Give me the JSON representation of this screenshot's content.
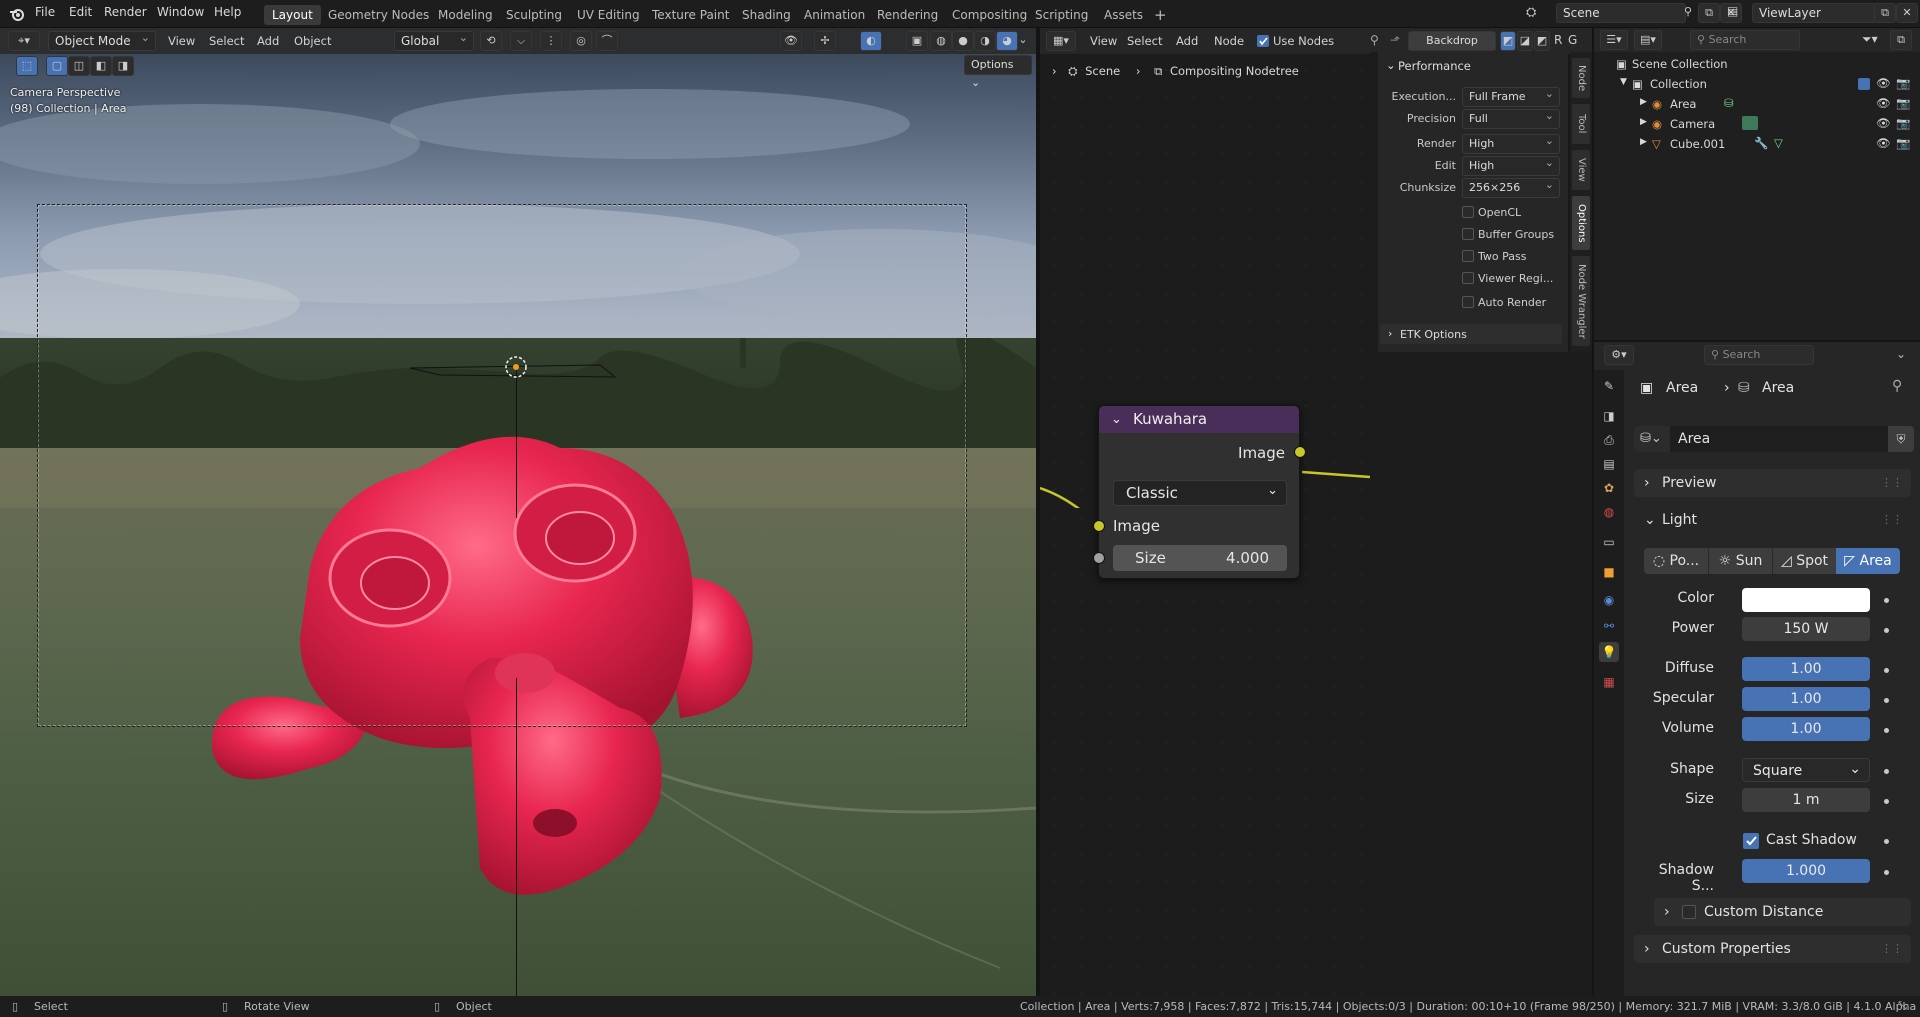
{
  "topbar": {
    "menus": [
      "File",
      "Edit",
      "Render",
      "Window",
      "Help"
    ],
    "workspaces": [
      "Layout",
      "Geometry Nodes",
      "Modeling",
      "Sculpting",
      "UV Editing",
      "Texture Paint",
      "Shading",
      "Animation",
      "Rendering",
      "Compositing",
      "Scripting",
      "Assets"
    ],
    "active_workspace": "Layout",
    "add_tab": "+",
    "scene": "Scene",
    "view_layer": "ViewLayer"
  },
  "viewport": {
    "mode": "Object Mode",
    "menus": [
      "View",
      "Select",
      "Add",
      "Object"
    ],
    "orientation": "Global",
    "options_label": "Options",
    "overlay_line1": "Camera Perspective",
    "overlay_line2": "(98) Collection | Area"
  },
  "node_editor": {
    "menus": [
      "View",
      "Select",
      "Add",
      "Node"
    ],
    "use_nodes_label": "Use Nodes",
    "use_nodes_checked": true,
    "backdrop_label": "Backdrop",
    "breadcrumb_scene": "Scene",
    "breadcrumb_tree": "Compositing Nodetree",
    "node": {
      "title": "Kuwahara",
      "output_label": "Image",
      "variation": "Classic",
      "input_label": "Image",
      "size_label": "Size",
      "size_value": "4.000"
    }
  },
  "performance_panel": {
    "title": "Performance",
    "rows": [
      {
        "label": "Execution...",
        "value": "Full Frame"
      },
      {
        "label": "Precision",
        "value": "Full"
      },
      {
        "label": "Render",
        "value": "High"
      },
      {
        "label": "Edit",
        "value": "High"
      },
      {
        "label": "Chunksize",
        "value": "256×256"
      }
    ],
    "checkboxes": [
      "OpenCL",
      "Buffer Groups",
      "Two Pass",
      "Viewer Regi...",
      "Auto Render"
    ],
    "etk_label": "ETK Options",
    "side_tabs": [
      "Node",
      "Tool",
      "View",
      "Options",
      "Node Wrangler"
    ]
  },
  "outliner": {
    "search_placeholder": "Search",
    "root": "Scene Collection",
    "collection": "Collection",
    "items": [
      "Area",
      "Camera",
      "Cube.001"
    ]
  },
  "properties": {
    "search_placeholder": "Search",
    "breadcrumb_object": "Area",
    "breadcrumb_data": "Area",
    "datablock_name": "Area",
    "sections": {
      "preview": "Preview",
      "light": "Light",
      "custom_distance": "Custom Distance",
      "custom_properties": "Custom Properties"
    },
    "light_types": [
      "Po...",
      "Sun",
      "Spot",
      "Area"
    ],
    "active_light_type": "Area",
    "color_label": "Color",
    "color_value": "#ffffff",
    "power_label": "Power",
    "power_value": "150 W",
    "diffuse_label": "Diffuse",
    "diffuse_value": "1.00",
    "specular_label": "Specular",
    "specular_value": "1.00",
    "volume_label": "Volume",
    "volume_value": "1.00",
    "shape_label": "Shape",
    "shape_value": "Square",
    "size_label": "Size",
    "size_value": "1 m",
    "cast_shadow_label": "Cast Shadow",
    "cast_shadow_checked": true,
    "shadow_soft_label": "Shadow S...",
    "shadow_soft_value": "1.000"
  },
  "statusbar": {
    "select": "Select",
    "rotate": "Rotate View",
    "object": "Object",
    "stats": "Collection | Area | Verts:7,958 | Faces:7,872 | Tris:15,744 | Objects:0/3 | Duration: 00:10+10 (Frame 98/250) | Memory: 321.7 MiB | VRAM: 3.3/8.0 GiB | 4.1.0 Alpha"
  },
  "colors": {
    "accent_blue": "#4772b3",
    "socket_yellow": "#c7c729",
    "node_header": "#4a2e5a",
    "suzanne_red": "#d91e47"
  }
}
